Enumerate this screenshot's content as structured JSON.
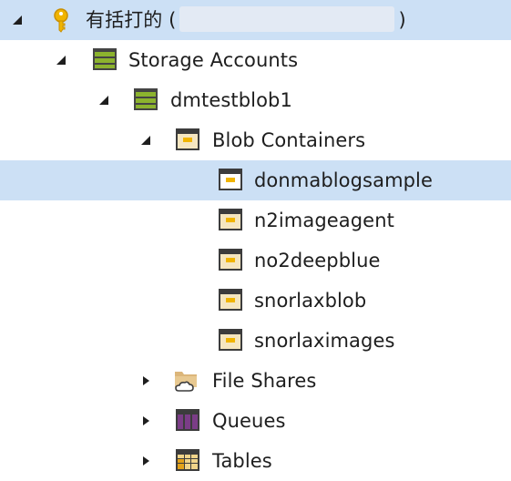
{
  "subscription": {
    "label": "有括打的 (",
    "label_suffix": ")",
    "icon": "key-icon"
  },
  "storage_accounts": {
    "label": "Storage Accounts",
    "icon": "storage-accounts-icon"
  },
  "account": {
    "label": "dmtestblob1",
    "icon": "storage-account-icon"
  },
  "blob_containers": {
    "label": "Blob Containers",
    "icon": "blob-container-icon",
    "items": [
      {
        "label": "donmablogsample",
        "selected": true
      },
      {
        "label": "n2imageagent"
      },
      {
        "label": "no2deepblue"
      },
      {
        "label": "snorlaxblob"
      },
      {
        "label": "snorlaximages"
      }
    ]
  },
  "file_shares": {
    "label": "File Shares",
    "icon": "file-shares-icon"
  },
  "queues": {
    "label": "Queues",
    "icon": "queues-icon"
  },
  "tables": {
    "label": "Tables",
    "icon": "tables-icon"
  },
  "colors": {
    "selection": "#cce0f5",
    "storage_green": "#8cb32e",
    "queue_purple": "#7b3d87",
    "key_gold": "#f0b400"
  }
}
